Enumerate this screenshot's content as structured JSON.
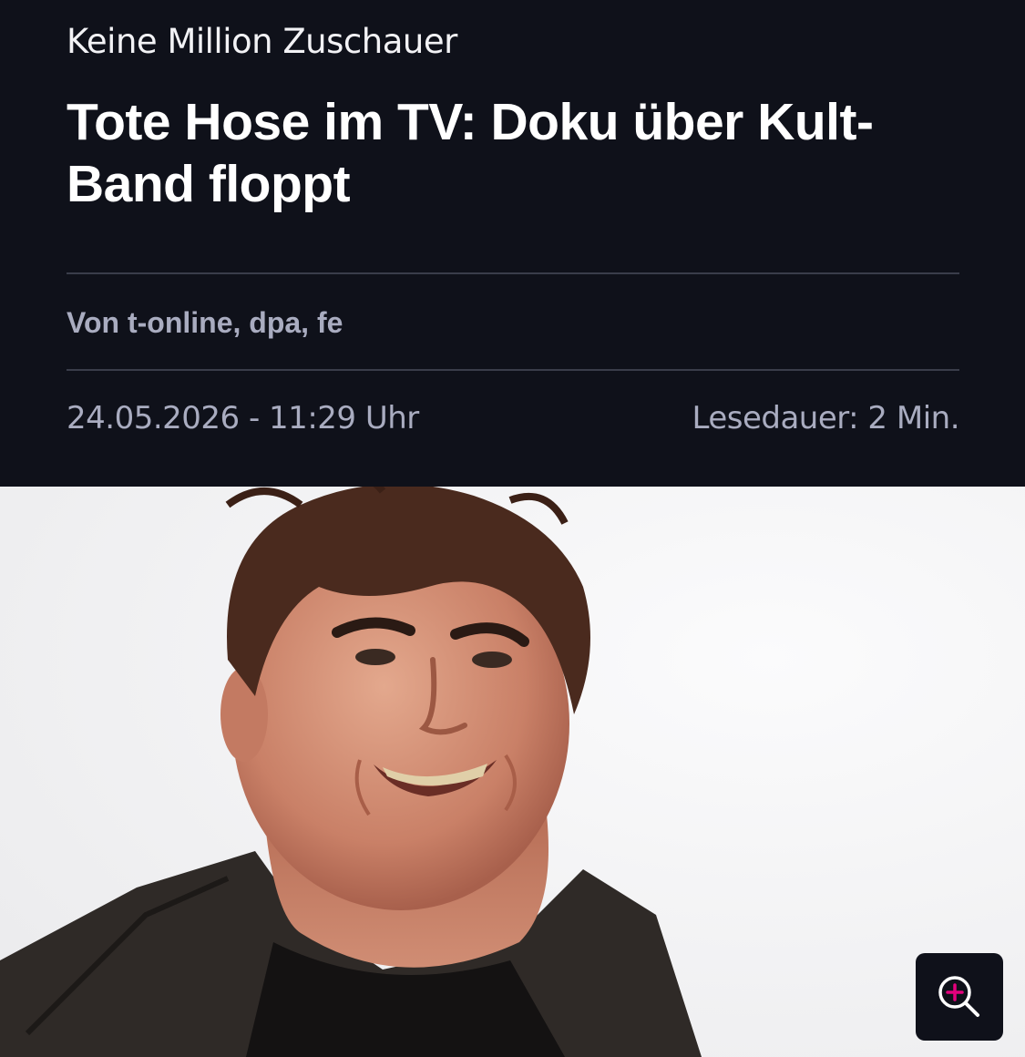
{
  "article": {
    "kicker": "Keine Million Zuschauer",
    "headline": "Tote Hose im TV: Doku über Kult-Band floppt",
    "byline": "Von t-online, dpa, fe",
    "date": "24.05.2026 - 11:29 Uhr",
    "reading_time": "Lesedauer: 2 Min."
  },
  "image": {
    "zoom_icon": "zoom-in-icon"
  },
  "colors": {
    "background": "#0f111a",
    "text_primary": "#ffffff",
    "text_muted": "#a9acc0",
    "divider": "#3a3d4a",
    "accent": "#e5007d"
  }
}
